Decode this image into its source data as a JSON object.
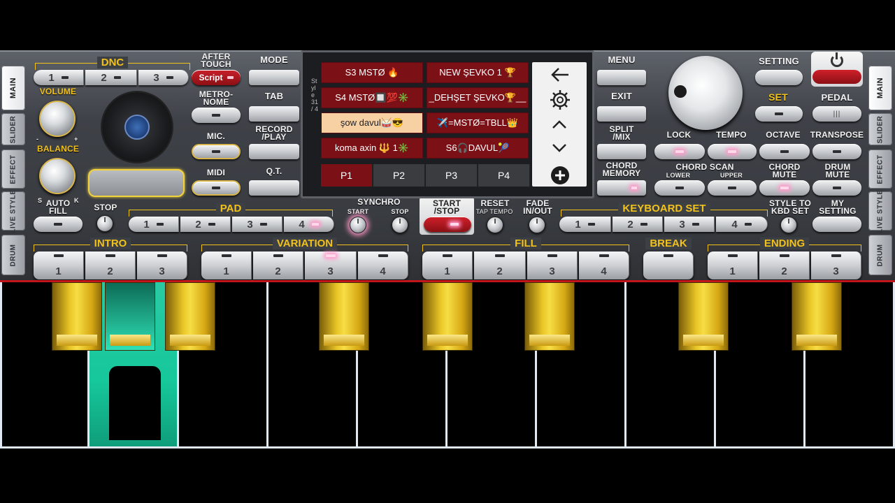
{
  "side_tabs": {
    "left": [
      "MAIN",
      "SLIDER",
      "EFFECT",
      "LIVE STYLE",
      "DRUM"
    ],
    "right": [
      "MAIN",
      "SLIDER",
      "EFFECT",
      "LIVE STYLE",
      "DRUM"
    ],
    "active": "MAIN"
  },
  "dnc": {
    "label": "DNC",
    "buttons": [
      "1",
      "2",
      "3"
    ],
    "script_label": "Script"
  },
  "after_touch": "AFTER\nTOUCH",
  "metronome": "METRO-\nNOME",
  "mic": "MIC.",
  "midi": "MIDI",
  "volume": {
    "label": "VOLUME",
    "minus": "-",
    "plus": "+"
  },
  "balance": {
    "label": "BALANCE",
    "s": "S",
    "k": "K"
  },
  "left_menu": {
    "mode": "MODE",
    "tab": "TAB",
    "record_play": "RECORD\n/PLAY",
    "qt": "Q.T."
  },
  "screen": {
    "side_text": "Style 31 / 4",
    "styles": [
      [
        "S3 MSTØ 🔥",
        "NEW ŞEVKO 1 🏆"
      ],
      [
        "S4 MSTØ🔲💯✳️",
        "_DEHŞET ŞEVKO🏆__"
      ],
      [
        "şow davul🥁😎",
        "✈️=MSTØ=TBLL👑"
      ],
      [
        "koma axin 🔱 1✳️",
        "S6🎧DAVUL🎾"
      ]
    ],
    "selected": "şow davul🥁😎",
    "pages": [
      "P1",
      "P2",
      "P3",
      "P4"
    ],
    "active_page": "P1",
    "nav_icons": [
      "back-arrow-icon",
      "gear-icon",
      "chevron-up-icon",
      "chevron-down-icon",
      "plus-circle-icon"
    ]
  },
  "right_menu": {
    "menu": "MENU",
    "exit": "EXIT",
    "split_mix": "SPLIT\n/MIX",
    "chord_memory": "CHORD\nMEMORY"
  },
  "top_right": {
    "setting": "SETTING",
    "set": "SET",
    "pedal": "PEDAL",
    "lock": "LOCK",
    "tempo": "TEMPO",
    "octave": "OCTAVE",
    "transpose": "TRANSPOSE",
    "chord_scan": "CHORD SCAN",
    "lower": "LOWER",
    "upper": "UPPER",
    "chord_mute": "CHORD\nMUTE",
    "drum_mute": "DRUM\nMUTE"
  },
  "row3": {
    "auto_fill": "AUTO\nFILL",
    "stop": "STOP",
    "pad": "PAD",
    "pad_buttons": [
      "1",
      "2",
      "3",
      "4"
    ],
    "synchro": "SYNCHRO",
    "synchro_start": "START",
    "synchro_stop": "STOP",
    "start_stop": "START\n/STOP",
    "reset": "RESET",
    "tap_tempo": "TAP TEMPO",
    "fade": "FADE\nIN/OUT",
    "keyboard_set": "KEYBOARD SET",
    "kbd_buttons": [
      "1",
      "2",
      "3",
      "4"
    ],
    "style_to_kbd": "STYLE TO\nKBD SET",
    "my_setting": "MY\nSETTING"
  },
  "row4": {
    "intro": {
      "label": "INTRO",
      "buttons": [
        "1",
        "2",
        "3"
      ]
    },
    "variation": {
      "label": "VARIATION",
      "buttons": [
        "1",
        "2",
        "3",
        "4"
      ],
      "active": "3"
    },
    "fill": {
      "label": "FILL",
      "buttons": [
        "1",
        "2",
        "3",
        "4"
      ]
    },
    "break": {
      "label": "BREAK"
    },
    "ending": {
      "label": "ENDING",
      "buttons": [
        "1",
        "2",
        "3"
      ]
    }
  },
  "colors": {
    "accent": "#f2c21b",
    "screen_cell": "#7b1016",
    "selected_cell": "#f7d1a4",
    "pressed_key": "#2ee0b5"
  }
}
